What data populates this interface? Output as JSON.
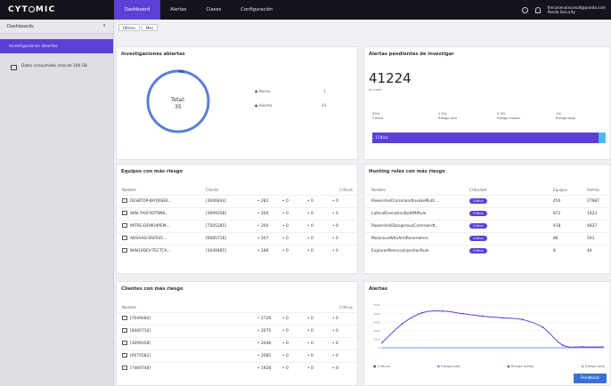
{
  "app": {
    "logo_text": "CYT",
    "logo_rest": "MIC"
  },
  "nav": {
    "items": [
      {
        "label": "Dashboard",
        "active": true
      },
      {
        "label": "Alertas",
        "active": false
      },
      {
        "label": "Clases",
        "active": false
      },
      {
        "label": "Configuración",
        "active": false
      }
    ],
    "user_email": "thecasenaixcosult@panda.com",
    "user_org": "Panda Security"
  },
  "sidebar": {
    "title": "Dashboards",
    "active_item": "Investigaciones abiertas",
    "alert_text": "Datos consumidos más de 100 GB"
  },
  "filters": [
    "Último",
    "Mes"
  ],
  "investigaciones": {
    "title": "Investigaciones abiertas",
    "total_label": "Total:",
    "total_value": "35",
    "legend": [
      {
        "label": "Nuevo",
        "value": "1"
      },
      {
        "label": "Abierta",
        "value": "34"
      }
    ]
  },
  "alertas_pendientes": {
    "title": "Alertas pendientes de investigar",
    "value": "41224",
    "sublabel": "en total",
    "breakdown": [
      {
        "pct": "49%",
        "label": "Crítica"
      },
      {
        "pct": "0.5%",
        "label": "Riesgo alto"
      },
      {
        "pct": "0.3%",
        "label": "Riesgo medio"
      },
      {
        "pct": "1%",
        "label": "Riesgo bajo"
      }
    ],
    "bar_label": "Crítica",
    "bar_fraction": 0.98
  },
  "equipos": {
    "title": "Equipos con más riesgo",
    "headers": [
      "Nombre",
      "Cliente",
      "Críticas",
      "Altas",
      "Medias",
      "Bajas"
    ],
    "rows": [
      {
        "name": "DESKTOP-8HYJ0SEK...",
        "client": "[3046834]",
        "crit": "282",
        "a": "0",
        "m": "0",
        "b": "0"
      },
      {
        "name": "WIN-7ASFXOTN9K...",
        "client": "[3099358]",
        "crit": "204",
        "a": "0",
        "m": "0",
        "b": "0"
      },
      {
        "name": "MITRE-DEMO4PEM...",
        "client": "[7505285]",
        "crit": "204",
        "a": "0",
        "m": "0",
        "b": "0"
      },
      {
        "name": "ADSAAD-0S0545...",
        "client": "[6085716]",
        "crit": "207",
        "a": "0",
        "m": "0",
        "b": "0"
      },
      {
        "name": "WIN10DEV-TECTCA...",
        "client": "[3049485]",
        "crit": "188",
        "a": "0",
        "m": "0",
        "b": "0"
      }
    ]
  },
  "hunting": {
    "title": "Hunting rules con más riesgo",
    "headers": [
      "Nombre",
      "Criticidad",
      "Equipos",
      "Alertas"
    ],
    "rows": [
      {
        "name": "PowershellCommandInvokeMulti...",
        "crit": "Crítica",
        "equipos": "450",
        "alertas": "27687"
      },
      {
        "name": "LateralExecutionByWMIRule",
        "crit": "Crítica",
        "equipos": "872",
        "alertas": "1923"
      },
      {
        "name": "PowershellDangerousCommandt...",
        "crit": "Crítica",
        "equipos": "418",
        "alertas": "4837"
      },
      {
        "name": "MaliciousWhoAmIParameters",
        "crit": "Crítica",
        "equipos": "86",
        "alertas": "541"
      },
      {
        "name": "ExplorerMemoryInjectionRule",
        "crit": "Crítica",
        "equipos": "8",
        "alertas": "44"
      }
    ]
  },
  "clientes": {
    "title": "Clientes con más riesgo",
    "headers": [
      "Nombre",
      "Críticas"
    ],
    "rows": [
      {
        "name": "[7049484]",
        "crit": "2728",
        "a": "0",
        "m": "0",
        "b": "0"
      },
      {
        "name": "[8085716]",
        "crit": "2075",
        "a": "0",
        "m": "0",
        "b": "0"
      },
      {
        "name": "[3099358]",
        "crit": "2048",
        "a": "0",
        "m": "0",
        "b": "0"
      },
      {
        "name": "[6075582]",
        "crit": "2085",
        "a": "0",
        "m": "0",
        "b": "0"
      },
      {
        "name": "[7469748]",
        "crit": "1928",
        "a": "0",
        "m": "0",
        "b": "0"
      }
    ]
  },
  "alertas_chart": {
    "title": "Alertas",
    "legend": [
      "Críticas",
      "Riesgo alto",
      "Riesgo medio",
      "Riesgo bajo"
    ],
    "cta": "Feedback"
  },
  "chart_data": {
    "type": "line",
    "x": [
      1,
      2,
      3,
      4,
      5,
      6,
      7,
      8,
      9,
      10,
      11,
      12
    ],
    "series": [
      {
        "name": "Críticas",
        "values": [
          600,
          2800,
          4100,
          4300,
          4000,
          3700,
          3500,
          3300,
          2400,
          300,
          100,
          100
        ]
      },
      {
        "name": "Riesgo alto",
        "values": [
          0,
          0,
          0,
          0,
          0,
          0,
          0,
          0,
          0,
          0,
          0,
          0
        ]
      },
      {
        "name": "Riesgo medio",
        "values": [
          0,
          0,
          0,
          0,
          0,
          0,
          0,
          0,
          0,
          0,
          0,
          0
        ]
      },
      {
        "name": "Riesgo bajo",
        "values": [
          0,
          0,
          0,
          0,
          0,
          0,
          0,
          0,
          0,
          0,
          0,
          0
        ]
      }
    ],
    "ylim": [
      0,
      5000
    ],
    "colors": {
      "crit": "#5b3fd6",
      "alto": "#8e8cff",
      "medio": "#3a7bd5",
      "bajo": "#6cc7ff"
    }
  }
}
